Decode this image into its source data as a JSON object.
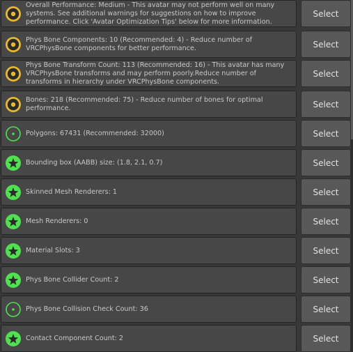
{
  "colors": {
    "panel_bg": "#383838",
    "row_bg": "#474747",
    "button_bg": "#585858",
    "text": "#c8c8c8",
    "warning_yellow": "#e8b92b",
    "good_green": "#4ee24e",
    "icon_dark": "#2a2a2a"
  },
  "rows": [
    {
      "status": "medium",
      "icon": "medium-ring-icon",
      "message": "Overall Performance: Medium - This avatar may not perform well on many\nsystems. See additional warnings for suggestions on how to improve\nperformance. Click 'Avatar Optimization Tips' below for more information.",
      "button_label": "Select"
    },
    {
      "status": "medium",
      "icon": "medium-ring-icon",
      "message": "Phys Bone Components: 10 (Recommended: 4) - Reduce number of\nVRCPhysBone components for better performance.",
      "button_label": "Select"
    },
    {
      "status": "medium",
      "icon": "medium-ring-icon",
      "message": "Phys Bone Transform Count: 113 (Recommended: 16) - This avatar has many\nVRCPhysBone transforms and may perform poorly.Reduce number of\ntransforms in hierarchy under VRCPhysBone components.",
      "button_label": "Select"
    },
    {
      "status": "medium",
      "icon": "medium-ring-icon",
      "message": "Bones: 218 (Recommended: 75) - Reduce number of bones for optimal\nperformance.",
      "button_label": "Select"
    },
    {
      "status": "good",
      "icon": "good-dot-icon",
      "message": "Polygons: 67431 (Recommended: 32000)",
      "button_label": "Select"
    },
    {
      "status": "excellent",
      "icon": "excellent-star-icon",
      "message": "Bounding box (AABB) size: (1.8, 2.1, 0.7)",
      "button_label": "Select"
    },
    {
      "status": "excellent",
      "icon": "excellent-star-icon",
      "message": "Skinned Mesh Renderers: 1",
      "button_label": "Select"
    },
    {
      "status": "excellent",
      "icon": "excellent-star-icon",
      "message": "Mesh Renderers: 0",
      "button_label": "Select"
    },
    {
      "status": "excellent",
      "icon": "excellent-star-icon",
      "message": "Material Slots: 3",
      "button_label": "Select"
    },
    {
      "status": "excellent",
      "icon": "excellent-star-icon",
      "message": "Phys Bone Collider Count: 2",
      "button_label": "Select"
    },
    {
      "status": "good",
      "icon": "good-dot-icon",
      "message": "Phys Bone Collision Check Count: 36",
      "button_label": "Select"
    },
    {
      "status": "excellent",
      "icon": "excellent-star-icon",
      "message": "Contact Component Count: 2",
      "button_label": "Select"
    }
  ]
}
